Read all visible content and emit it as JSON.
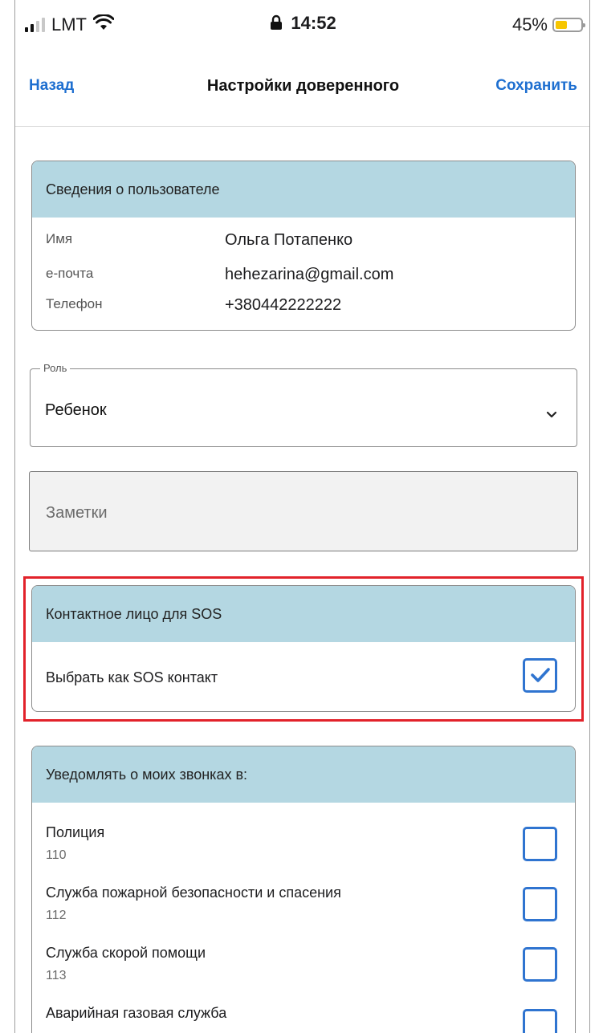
{
  "status_bar": {
    "carrier": "LMT",
    "time": "14:52",
    "battery_percent": "45%",
    "battery_level": 0.45,
    "icons": [
      "signal-icon",
      "wifi-icon",
      "lock-icon",
      "battery-icon"
    ]
  },
  "nav": {
    "back_label": "Назад",
    "title": "Настройки доверенного",
    "save_label": "Сохранить"
  },
  "user_info": {
    "header": "Сведения о пользователе",
    "rows": [
      {
        "label": "Имя",
        "value": "Ольга Потапенко"
      },
      {
        "label": "е-почта",
        "value": "hehezarina@gmail.com"
      },
      {
        "label": "Телефон",
        "value": "+380442222222"
      }
    ]
  },
  "role": {
    "legend": "Роль",
    "value": "Ребенок"
  },
  "notes": {
    "placeholder": "Заметки"
  },
  "sos": {
    "header": "Контактное лицо для SOS",
    "option_label": "Выбрать как SOS контакт",
    "checked": true
  },
  "notify": {
    "header": "Уведомлять о моих звонках в:",
    "services": [
      {
        "name": "Полиция",
        "number": "110",
        "checked": false
      },
      {
        "name": "Служба пожарной безопасности и спасения",
        "number": "112",
        "checked": false
      },
      {
        "name": "Служба скорой помощи",
        "number": "113",
        "checked": false
      },
      {
        "name": "Аварийная газовая служба",
        "number": "",
        "checked": false
      }
    ]
  },
  "colors": {
    "accent": "#1e6fd0",
    "card_header": "#b4d7e2",
    "checkbox": "#2f74d0",
    "highlight": "#e2222a",
    "battery": "#f7c600"
  }
}
